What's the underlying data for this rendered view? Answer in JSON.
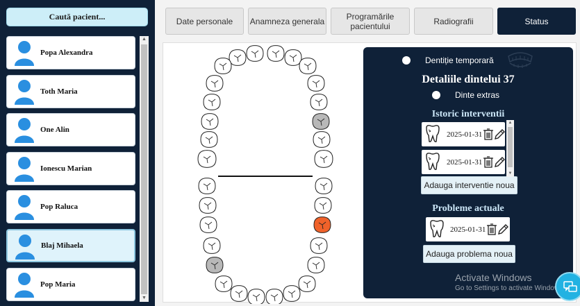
{
  "search": {
    "label": "Caută pacient..."
  },
  "patients": [
    {
      "name": "Popa Alexandra",
      "selected": false
    },
    {
      "name": "Toth Maria",
      "selected": false
    },
    {
      "name": "One Alin",
      "selected": false
    },
    {
      "name": "Ionescu Marian",
      "selected": false
    },
    {
      "name": "Pop Raluca",
      "selected": false
    },
    {
      "name": "Blaj Mihaela",
      "selected": true
    },
    {
      "name": "Pop Maria",
      "selected": false
    }
  ],
  "tabs": [
    {
      "label": "Date personale",
      "active": false
    },
    {
      "label": "Anamneza generala",
      "active": false
    },
    {
      "label": "Programările pacientului",
      "active": false
    },
    {
      "label": "Radiografii",
      "active": false
    },
    {
      "label": "Status",
      "active": true
    }
  ],
  "detail": {
    "temporary_label": "Dentiție temporară",
    "title": "Detaliile dintelui 37",
    "extracted_label": "Dinte extras",
    "history_title": "Istoric interventii",
    "interventions": [
      {
        "date": "2025-01-31"
      },
      {
        "date": "2025-01-31"
      }
    ],
    "add_intervention": "Adauga interventie noua",
    "problems_title": "Probleme actuale",
    "problems": [
      {
        "date": "2025-01-31"
      }
    ],
    "add_problem": "Adauga problema noua"
  },
  "watermark": {
    "line1": "Activate Windows",
    "line2": "Go to Settings to activate Windows."
  },
  "colors": {
    "navy": "#0f2138",
    "tooth_grey": "#b8b8b8",
    "tooth_orange": "#f0622a",
    "accent_light": "#cbe6f7"
  }
}
